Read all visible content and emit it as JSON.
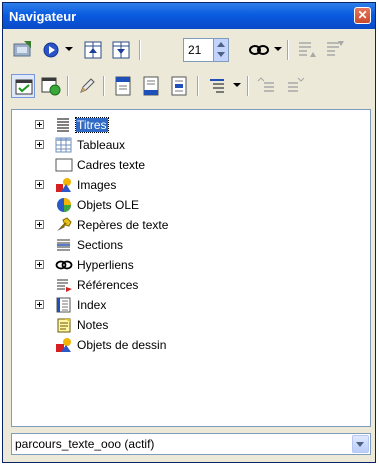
{
  "window": {
    "title": "Navigateur",
    "close_glyph": "✕"
  },
  "toolbar": {
    "page_number": "21"
  },
  "tree": {
    "items": [
      {
        "label": "Titres",
        "icon": "headings-icon",
        "expandable": true,
        "selected": true
      },
      {
        "label": "Tableaux",
        "icon": "table-icon",
        "expandable": true
      },
      {
        "label": "Cadres texte",
        "icon": "text-frame-icon",
        "expandable": false
      },
      {
        "label": "Images",
        "icon": "image-icon",
        "expandable": true
      },
      {
        "label": "Objets OLE",
        "icon": "ole-object-icon",
        "expandable": false
      },
      {
        "label": "Repères de texte",
        "icon": "bookmark-icon",
        "expandable": true
      },
      {
        "label": "Sections",
        "icon": "section-icon",
        "expandable": false
      },
      {
        "label": "Hyperliens",
        "icon": "hyperlink-icon",
        "expandable": true
      },
      {
        "label": "Références",
        "icon": "reference-icon",
        "expandable": false
      },
      {
        "label": "Index",
        "icon": "index-icon",
        "expandable": true
      },
      {
        "label": "Notes",
        "icon": "note-icon",
        "expandable": false
      },
      {
        "label": "Objets de dessin",
        "icon": "drawing-object-icon",
        "expandable": false
      }
    ]
  },
  "document_selector": {
    "value": "parcours_texte_ooo (actif)"
  }
}
